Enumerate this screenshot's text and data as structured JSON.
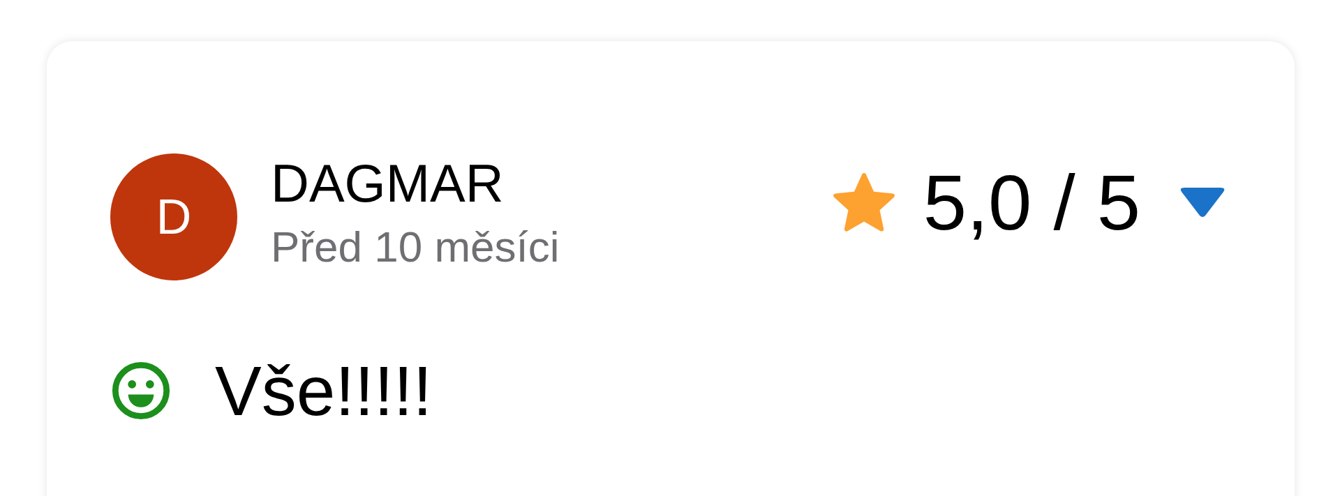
{
  "review": {
    "avatar_letter": "D",
    "author": "DAGMAR",
    "time": "Před 10 měsíci",
    "rating": "5,0 / 5",
    "comment": "Vše!!!!!"
  }
}
